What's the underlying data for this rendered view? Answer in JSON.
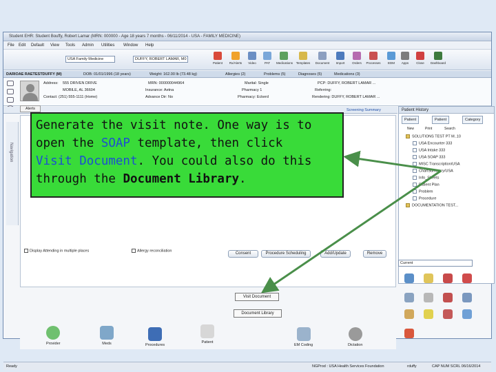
{
  "window": {
    "title": "Student EHR: Student Bouffy, Robert Lamar (MRN: 000000 - Age 18 years 7 months - 06/11/2014 - USA - FAMILY MEDICINE)"
  },
  "menu": [
    "File",
    "Edit",
    "Default",
    "View",
    "Tools",
    "Admin",
    "Utilities",
    "Window",
    "Help"
  ],
  "toolbar": {
    "facility_value": "USA Family Medicine",
    "provider_value": "DUFFY, ROBERT LAMAR, M0",
    "buttons": [
      "Patient",
      "Rx/Alerts",
      "Video",
      "PAT",
      "Medications",
      "Templates",
      "Document",
      "Import",
      "Orders",
      "Processes",
      "EDM",
      "Apps",
      "Close",
      "Dashboard"
    ]
  },
  "patient_bar": {
    "name": "DARIOAE RAETESTDUFFY (M)",
    "dob": "DOB: 01/01/1996 (18 years)",
    "weight": "Weight: 162.00 lb (73.48 kg)",
    "allergies": "Allergies (2)",
    "problems": "Problems (5)",
    "diagnoses": "Diagnoses (5)",
    "meds": "Medications (3)"
  },
  "demographics": {
    "address_label": "Address:",
    "address_line1": "555 DRIVEN DRIVE",
    "address_line2": "MOBILE, AL 36604",
    "contact": "Contact: (251) 555-1111 (Home)",
    "mrn": "MRN: 000000044964",
    "insurance": "Insurance: Aetna",
    "advance": "Advance Dir: No",
    "marital": "Marital: Single",
    "pharmacy1": "Pharmacy 1",
    "pharmacy2": "Pharmacy: Eckerd",
    "pcp": "PCP: DUFFY, ROBERT LAMAR ...",
    "referring": "Referring:",
    "rendering": "Rendering: DUFFY, ROBERT LAMAR ..."
  },
  "alert_tab": "Alerts",
  "screening_link": "Screening Summary",
  "nav_label": "Navigation",
  "bottom_checks": [
    "Display Attending in multiple places",
    "Allergy reconciliation"
  ],
  "action_buttons": [
    "Consent",
    "Procedure Scheduling",
    "Add/Update",
    "Remove"
  ],
  "tools": [
    {
      "label": "Provider",
      "icon": "provider-icon"
    },
    {
      "label": "Meds",
      "icon": "meds-icon"
    },
    {
      "label": "Procedures",
      "icon": "procedures-icon"
    },
    {
      "label": "Patient",
      "icon": "patient-icon"
    },
    {
      "label": "EM Coding",
      "icon": "em-coding-icon"
    },
    {
      "label": "Dictation",
      "icon": "dictation-icon"
    }
  ],
  "visit_document_label": "Visit Document",
  "document_library_label": "Document Library",
  "right_panel": {
    "title": "Patient History",
    "tabs": [
      "Patient",
      "Patient",
      "Category"
    ],
    "tools": [
      "New",
      "Print",
      "Search"
    ],
    "tree_root": "SOLUTIONS TEST PT M..10",
    "tree_items": [
      "USA Encounter 333",
      "USA Intake 333",
      "USA SOAP 333",
      "MISC Transcription/USA",
      "ChartSummary/USA",
      "Info_Sheets",
      "Patient Plan",
      "Problem",
      "Procedure"
    ],
    "tree_root2": "DOCUMENTATION TEST...",
    "search_value": "Current"
  },
  "status": {
    "left": "Ready",
    "center": "NGProd : USA Health Services Foundation",
    "user": "rduffy",
    "right": "CAP  NUM  SCRL  06/16/2014"
  },
  "callout": {
    "line1_a": "Generate the visit note.  One way is to",
    "line2_a": "open the ",
    "line2_b": "SOAP",
    "line2_c": " template, then click",
    "line3_a": "Visit Document",
    "line3_b": ".  You could also do this",
    "line4_a": "through the ",
    "line4_b": "Document Library",
    "line4_c": ".",
    "background": "#39db39",
    "highlight_color": "#1c4fd1"
  }
}
